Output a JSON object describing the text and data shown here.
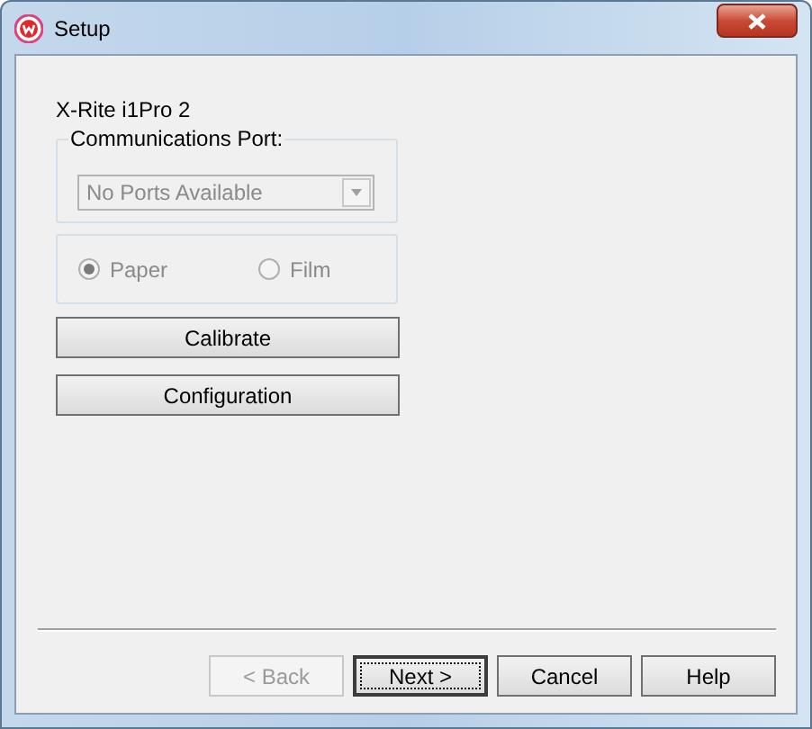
{
  "window": {
    "title": "Setup"
  },
  "device_label": "X-Rite i1Pro 2",
  "port_group": {
    "label": "Communications Port:",
    "dropdown": {
      "value": "No Ports Available",
      "disabled": true
    }
  },
  "media": [
    {
      "label": "Paper",
      "selected": true,
      "disabled": true
    },
    {
      "label": "Film",
      "selected": false,
      "disabled": true
    }
  ],
  "actions": [
    {
      "label": "Calibrate"
    },
    {
      "label": "Configuration"
    }
  ],
  "buttons": [
    {
      "label": "< Back",
      "disabled": true,
      "default": false
    },
    {
      "label": "Next >",
      "disabled": false,
      "default": true
    },
    {
      "label": "Cancel",
      "disabled": false,
      "default": false
    },
    {
      "label": "Help",
      "disabled": false,
      "default": false
    }
  ]
}
